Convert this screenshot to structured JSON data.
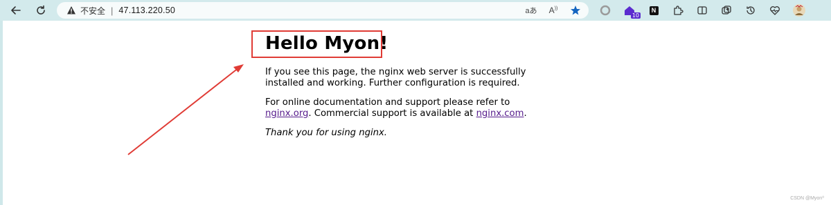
{
  "browser": {
    "back_icon": "back-arrow-icon",
    "reload_icon": "reload-icon",
    "security_label": "不安全",
    "separator": "|",
    "url": "47.113.220.50",
    "extension_badge_count": "10",
    "n_icon_label": "N"
  },
  "page": {
    "heading": "Hello Myon!",
    "para1": "If you see this page, the nginx web server is successfully installed and working. Further configuration is required.",
    "para2_prefix": "For online documentation and support please refer to ",
    "link1": "nginx.org",
    "para2_mid": ". Commercial support is available at ",
    "link2": "nginx.com",
    "para2_suffix": ".",
    "para3": "Thank you for using nginx."
  },
  "watermark": "CSDN @Myon⁰",
  "colors": {
    "chrome_bg": "#d3eaec",
    "annotation_red": "#e03b35",
    "link_purple": "#551a8b"
  }
}
